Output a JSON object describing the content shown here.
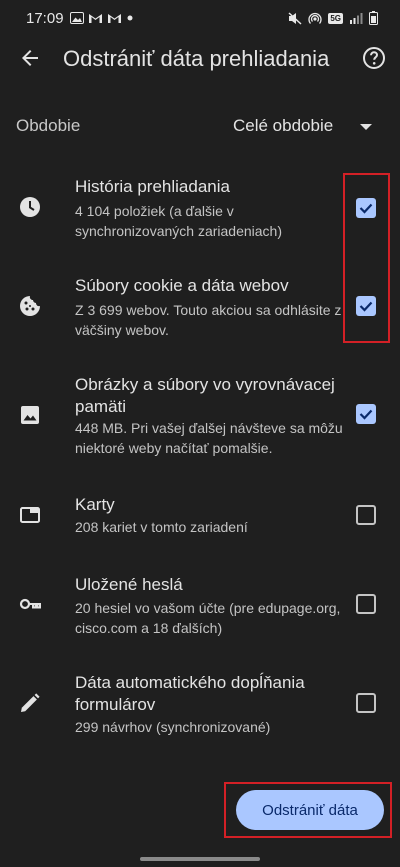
{
  "status_bar": {
    "time": "17:09",
    "left_icons": [
      "gallery-icon",
      "gmail-icon",
      "gmail-icon",
      "dot-icon"
    ],
    "right_icons": [
      "mute-icon",
      "hotspot-icon",
      "5g-icon",
      "signal-icon",
      "battery-icon"
    ],
    "network_label": "5G"
  },
  "header": {
    "title": "Odstrániť dáta prehliadania"
  },
  "period": {
    "label": "Obdobie",
    "value": "Celé obdobie"
  },
  "items": [
    {
      "title": "História prehliadania",
      "subtitle": "4 104 položiek (a ďalšie v synchronizovaných zariadeniach)",
      "checked": true,
      "icon": "clock-icon"
    },
    {
      "title": "Súbory cookie a dáta webov",
      "subtitle": "Z 3 699 webov. Touto akciou sa odhlásite z väčšiny webov.",
      "checked": true,
      "icon": "cookie-icon"
    },
    {
      "title": "Obrázky a súbory vo vyrovnávacej pamäti",
      "subtitle": "448 MB. Pri vašej ďalšej návšteve sa môžu niektoré weby načítať pomalšie.",
      "checked": true,
      "icon": "image-icon"
    },
    {
      "title": "Karty",
      "subtitle": "208 kariet v tomto zariadení",
      "checked": false,
      "icon": "tab-icon"
    },
    {
      "title": "Uložené heslá",
      "subtitle": "20 hesiel vo vašom účte (pre edupage.org, cisco.com a 18 ďalších)",
      "checked": false,
      "icon": "key-icon"
    },
    {
      "title": "Dáta automatického dopĺňania formulárov",
      "subtitle": "299 návrhov (synchronizované)",
      "checked": false,
      "icon": "pencil-icon"
    }
  ],
  "action": {
    "button_label": "Odstrániť dáta"
  },
  "colors": {
    "background": "#1f1f1f",
    "accent": "#aac7ff",
    "highlight": "#d32026"
  }
}
